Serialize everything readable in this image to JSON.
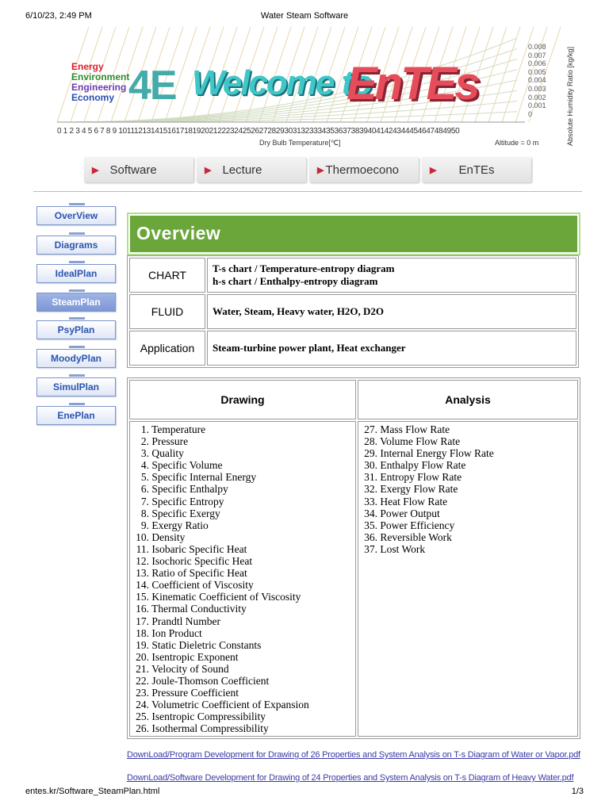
{
  "print_header": {
    "datetime": "6/10/23, 2:49 PM",
    "title": "Water Steam Software"
  },
  "print_footer": {
    "url": "entes.kr/Software_SteamPlan.html",
    "page": "1/3"
  },
  "banner": {
    "labels": [
      "Energy",
      "Environment",
      "Engineering",
      "Economy"
    ],
    "label_colors": [
      "#d81f2a",
      "#2f8c2f",
      "#6a3cb0",
      "#2a4fb0"
    ],
    "logo_4e": "4E",
    "welcome_text": "Welcome to",
    "brand_text": "EnTEs",
    "x_axis_ticks": "0 1 2 3 4 5 6 7 8 9 1011121314151617181920212223242526272829303132333435363738394041424344454647484950",
    "x_axis_label": "Dry Bulb Temperature[℃]",
    "altitude": "Altitude = 0 m",
    "y_axis_values": [
      "0.008",
      "0.007",
      "0.006",
      "0.005",
      "0.004",
      "0.003",
      "0.002",
      "0.001",
      "0"
    ],
    "y_axis_label": "Absolute Humidity Ratio [kg/kg]"
  },
  "top_nav": [
    {
      "label": "Software"
    },
    {
      "label": "Lecture"
    },
    {
      "label": "Thermoecono"
    },
    {
      "label": "EnTEs"
    }
  ],
  "side_menu": [
    {
      "label": "OverView"
    },
    {
      "label": "Diagrams"
    },
    {
      "label": "IdealPlan"
    },
    {
      "label": "SteamPlan"
    },
    {
      "label": "PsyPlan"
    },
    {
      "label": "MoodyPlan"
    },
    {
      "label": "SimulPlan"
    },
    {
      "label": "EnePlan"
    }
  ],
  "overview": {
    "title": "Overview",
    "rows": [
      {
        "key": "CHART",
        "lines": [
          "T-s chart / Temperature-entropy diagram",
          "h-s chart / Enthalpy-entropy diagram"
        ]
      },
      {
        "key": "FLUID",
        "lines": [
          "Water, Steam, Heavy water, H2O, D2O"
        ]
      },
      {
        "key": "Application",
        "lines": [
          "Steam-turbine power plant, Heat exchanger"
        ]
      }
    ]
  },
  "properties": {
    "drawing_header": "Drawing",
    "analysis_header": "Analysis",
    "drawing": [
      "1. Temperature",
      "2. Pressure",
      "3. Quality",
      "4. Specific Volume",
      "5. Specific Internal Energy",
      "6. Specific Enthalpy",
      "7. Specific Entropy",
      "8. Specific Exergy",
      "9. Exergy Ratio",
      "10. Density",
      "11. Isobaric Specific Heat",
      "12. Isochoric Specific Heat",
      "13. Ratio of Specific Heat",
      "14. Coefficient of Viscosity",
      "15. Kinematic Coefficient of Viscosity",
      "16. Thermal Conductivity",
      "17. Prandtl Number",
      "18. Ion Product",
      "19. Static Dieletric Constants",
      "20. Isentropic Exponent",
      "21. Velocity of Sound",
      "22. Joule-Thomson Coefficient",
      "23. Pressure Coefficient",
      "24. Volumetric Coefficient of Expansion",
      "25. Isentropic Compressibility",
      "26. Isothermal Compressibility"
    ],
    "analysis": [
      "27. Mass Flow Rate",
      "28. Volume Flow Rate",
      "29. Internal Energy Flow Rate",
      "30. Enthalpy Flow Rate",
      "31. Entropy Flow Rate",
      "32. Exergy Flow Rate",
      "33. Heat Flow Rate",
      "34. Power Output",
      "35. Power Efficiency",
      "36. Reversible Work",
      "37. Lost Work"
    ]
  },
  "downloads": [
    "DownLoad/Program Development for Drawing of 26 Properties and System Analysis on T-s Diagram of Water or Vapor.pdf",
    "DownLoad/Software Development for Drawing of 24 Properties and System Analysis on T-s Diagram of Heavy Water.pdf"
  ],
  "colors": {
    "accent_green": "#6aa63a",
    "side_active": "#8ea4db",
    "link": "#3a3aa8",
    "nav_arrow": "#c8283a"
  }
}
